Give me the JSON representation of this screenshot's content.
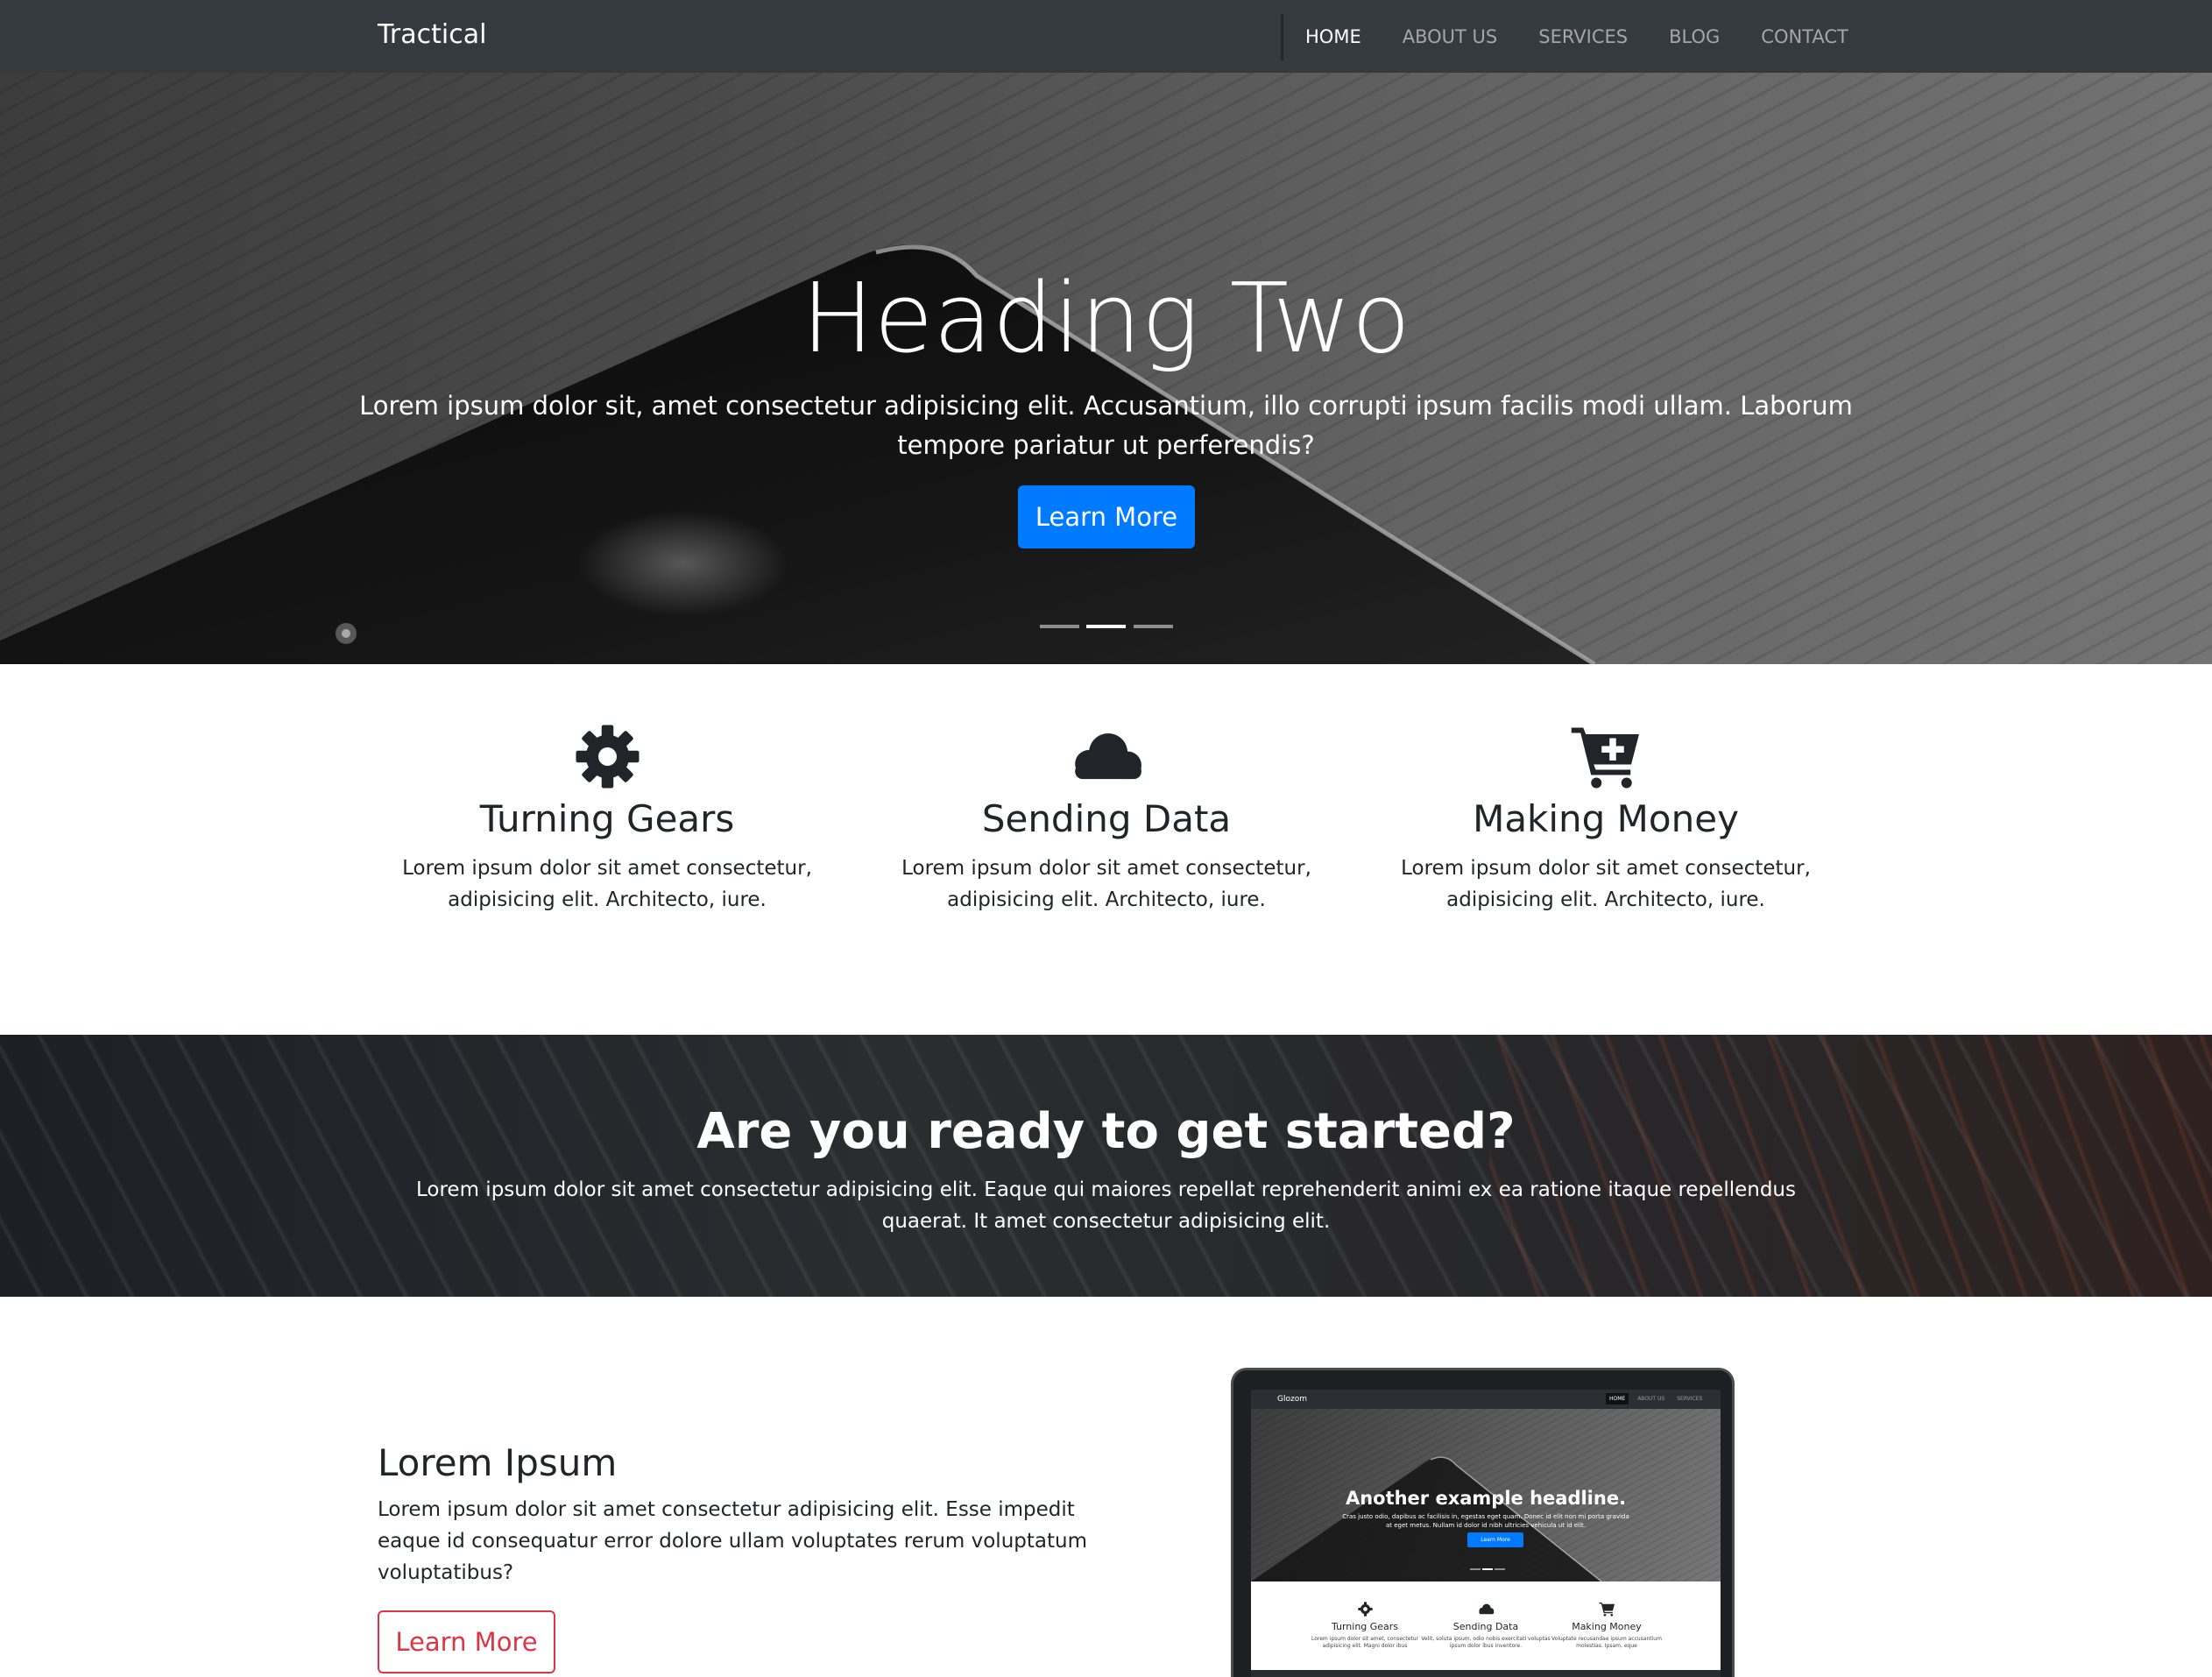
{
  "navbar": {
    "brand": "Tractical",
    "links": [
      {
        "label": "HOME",
        "active": true
      },
      {
        "label": "ABOUT US",
        "active": false
      },
      {
        "label": "SERVICES",
        "active": false
      },
      {
        "label": "BLOG",
        "active": false
      },
      {
        "label": "CONTACT",
        "active": false
      }
    ]
  },
  "hero": {
    "title": "Heading Two",
    "text": "Lorem ipsum dolor sit, amet consectetur adipisicing elit. Accusantium, illo corrupti ipsum facilis modi ullam. Laborum tempore pariatur ut perferendis?",
    "button": "Learn More",
    "slides": 3,
    "active_slide": 2
  },
  "features": [
    {
      "icon": "gear-icon",
      "title": "Turning Gears",
      "text": "Lorem ipsum dolor sit amet consectetur, adipisicing elit. Architecto, iure."
    },
    {
      "icon": "cloud-icon",
      "title": "Sending Data",
      "text": "Lorem ipsum dolor sit amet consectetur, adipisicing elit. Architecto, iure."
    },
    {
      "icon": "cart-plus-icon",
      "title": "Making Money",
      "text": "Lorem ipsum dolor sit amet consectetur, adipisicing elit. Architecto, iure."
    }
  ],
  "cta": {
    "title": "Are you ready to get started?",
    "text": "Lorem ipsum dolor sit amet consectetur adipisicing elit. Eaque qui maiores repellat reprehenderit animi ex ea ratione itaque repellendus quaerat. It amet consectetur adipisicing elit."
  },
  "info": {
    "title": "Lorem Ipsum",
    "text": "Lorem ipsum dolor sit amet consectetur adipisicing elit. Esse impedit eaque id consequatur error dolore ullam voluptates rerum voluptatum voluptatibus?",
    "button": "Learn More"
  },
  "laptop_preview": {
    "brand": "Glozom",
    "links": [
      {
        "label": "HOME",
        "active": true
      },
      {
        "label": "ABOUT US",
        "active": false
      },
      {
        "label": "SERVICES",
        "active": false
      }
    ],
    "title": "Another example headline.",
    "text": "Cras justo odio, dapibus ac facilisis in, egestas eget quam. Donec id elit non mi porta gravida at eget metus. Nullam id dolor id nibh ultricies vehicula ut id elit.",
    "button": "Learn More",
    "features": [
      {
        "title": "Turning Gears",
        "text": "Lorem ipsum dolor sit amet, consectetur adipisicing elit. Magni dolor ibus"
      },
      {
        "title": "Sending Data",
        "text": "Velit, soluta ipsum, odio nobis exercitati voluptas ipsum dolor ibus inventore."
      },
      {
        "title": "Making Money",
        "text": "Voluptate recusandae ipsum accusantium molestias. Ipsam, eque"
      }
    ]
  },
  "colors": {
    "navbar": "#343a40",
    "primary": "#007bff",
    "danger": "#dc3545",
    "icon": "#212529"
  }
}
